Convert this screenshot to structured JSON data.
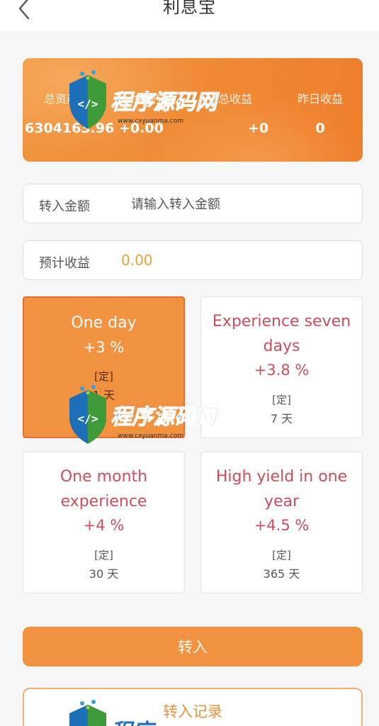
{
  "header": {
    "title": "利息宝",
    "back_icon": "chevron-left-icon"
  },
  "summary": {
    "stats": [
      {
        "label": "总资产",
        "value": "6304163.96"
      },
      {
        "label": "余额宝",
        "value": "+0.00"
      },
      {
        "label": "总收益",
        "value": "+0"
      },
      {
        "label": "昨日收益",
        "value": "0"
      }
    ],
    "colors": {
      "card": "#f08a35"
    }
  },
  "form": {
    "amount_label": "转入金额",
    "amount_placeholder": "请输入转入金额",
    "estimate_label": "预计收益",
    "estimate_value": "0.00"
  },
  "plans": [
    {
      "name": "One day",
      "rate": "+3 %",
      "type": "[定]",
      "days": "1 天",
      "selected": true
    },
    {
      "name": "Experience seven days",
      "rate": "+3.8 %",
      "type": "[定]",
      "days": "7 天",
      "selected": false
    },
    {
      "name": "One month experience",
      "rate": "+4 %",
      "type": "[定]",
      "days": "30 天",
      "selected": false
    },
    {
      "name": "High yield in one year",
      "rate": "+4.5 %",
      "type": "[定]",
      "days": "365 天",
      "selected": false
    }
  ],
  "actions": {
    "submit_label": "转入",
    "record_label": "转入记录"
  },
  "watermark": {
    "title": "程序源码网",
    "url": "www.cxyuanma.com"
  },
  "theme": {
    "accent": "#f0923f",
    "plan_text": "#cf4d5a",
    "estimate": "#e9a23b"
  }
}
